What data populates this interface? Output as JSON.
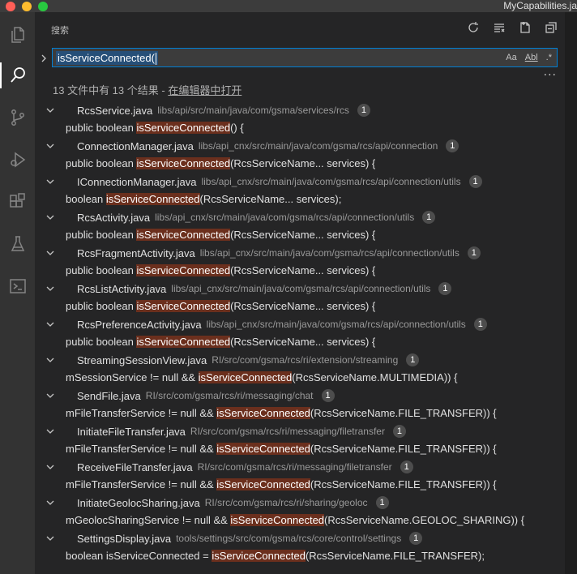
{
  "window": {
    "tab_title": "MyCapabilities.ja"
  },
  "activity_bar": [
    {
      "name": "files-icon",
      "active": false
    },
    {
      "name": "search-icon",
      "active": true
    },
    {
      "name": "source-control-icon",
      "active": false
    },
    {
      "name": "run-debug-icon",
      "active": false
    },
    {
      "name": "extensions-icon",
      "active": false
    },
    {
      "name": "testing-icon",
      "active": false
    },
    {
      "name": "remote-explorer-icon",
      "active": false
    }
  ],
  "search": {
    "header": "搜索",
    "query": "isServiceConnected(",
    "options": {
      "match_case": "Aa",
      "whole_word": "Abl",
      "regex": ".*"
    },
    "summary_text": "13 文件中有 13 个结果 - ",
    "open_in_editor": "在编辑器中打开"
  },
  "results": [
    {
      "file": "RcsService.java",
      "path": "libs/api/src/main/java/com/gsma/services/rcs",
      "count": "1",
      "before": "public boolean ",
      "match": "isServiceConnected",
      "after": "() {"
    },
    {
      "file": "ConnectionManager.java",
      "path": "libs/api_cnx/src/main/java/com/gsma/rcs/api/connection",
      "count": "1",
      "before": "public boolean ",
      "match": "isServiceConnected",
      "after": "(RcsServiceName... services) {"
    },
    {
      "file": "IConnectionManager.java",
      "path": "libs/api_cnx/src/main/java/com/gsma/rcs/api/connection/utils",
      "count": "1",
      "before": "boolean ",
      "match": "isServiceConnected",
      "after": "(RcsServiceName... services);"
    },
    {
      "file": "RcsActivity.java",
      "path": "libs/api_cnx/src/main/java/com/gsma/rcs/api/connection/utils",
      "count": "1",
      "before": "public boolean ",
      "match": "isServiceConnected",
      "after": "(RcsServiceName... services) {"
    },
    {
      "file": "RcsFragmentActivity.java",
      "path": "libs/api_cnx/src/main/java/com/gsma/rcs/api/connection/utils",
      "count": "1",
      "before": "public boolean ",
      "match": "isServiceConnected",
      "after": "(RcsServiceName... services) {"
    },
    {
      "file": "RcsListActivity.java",
      "path": "libs/api_cnx/src/main/java/com/gsma/rcs/api/connection/utils",
      "count": "1",
      "before": "public boolean ",
      "match": "isServiceConnected",
      "after": "(RcsServiceName... services) {"
    },
    {
      "file": "RcsPreferenceActivity.java",
      "path": "libs/api_cnx/src/main/java/com/gsma/rcs/api/connection/utils",
      "count": "1",
      "before": "public boolean ",
      "match": "isServiceConnected",
      "after": "(RcsServiceName... services) {"
    },
    {
      "file": "StreamingSessionView.java",
      "path": "RI/src/com/gsma/rcs/ri/extension/streaming",
      "count": "1",
      "before": "mSessionService != null && ",
      "match": "isServiceConnected",
      "after": "(RcsServiceName.MULTIMEDIA)) {"
    },
    {
      "file": "SendFile.java",
      "path": "RI/src/com/gsma/rcs/ri/messaging/chat",
      "count": "1",
      "before": "mFileTransferService != null && ",
      "match": "isServiceConnected",
      "after": "(RcsServiceName.FILE_TRANSFER)) {"
    },
    {
      "file": "InitiateFileTransfer.java",
      "path": "RI/src/com/gsma/rcs/ri/messaging/filetransfer",
      "count": "1",
      "before": "mFileTransferService != null && ",
      "match": "isServiceConnected",
      "after": "(RcsServiceName.FILE_TRANSFER)) {"
    },
    {
      "file": "ReceiveFileTransfer.java",
      "path": "RI/src/com/gsma/rcs/ri/messaging/filetransfer",
      "count": "1",
      "before": "mFileTransferService != null && ",
      "match": "isServiceConnected",
      "after": "(RcsServiceName.FILE_TRANSFER)) {"
    },
    {
      "file": "InitiateGeolocSharing.java",
      "path": "RI/src/com/gsma/rcs/ri/sharing/geoloc",
      "count": "1",
      "before": "mGeolocSharingService != null && ",
      "match": "isServiceConnected",
      "after": "(RcsServiceName.GEOLOC_SHARING)) {"
    },
    {
      "file": "SettingsDisplay.java",
      "path": "tools/settings/src/com/gsma/rcs/core/control/settings",
      "count": "1",
      "before": "boolean isServiceConnected = ",
      "match": "isServiceConnected",
      "after": "(RcsServiceName.FILE_TRANSFER);"
    }
  ],
  "colors": {
    "accent": "#007fd4",
    "match_highlight": "#6b2f1d",
    "sidebar_bg": "#252526",
    "activity_bg": "#333333"
  }
}
